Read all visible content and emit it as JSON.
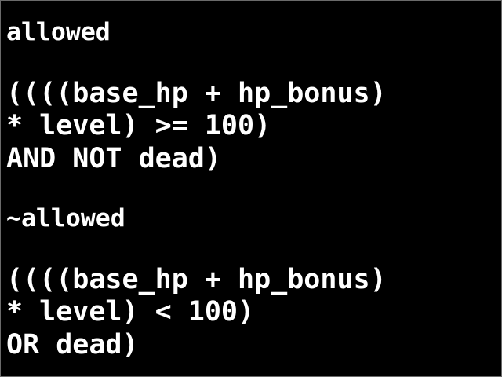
{
  "sections": [
    {
      "heading": "allowed",
      "lines": [
        "((((base_hp + hp_bonus)",
        "* level) >= 100)",
        "AND NOT dead)"
      ]
    },
    {
      "heading": "~allowed",
      "lines": [
        "((((base_hp + hp_bonus)",
        "* level) < 100)",
        "OR dead)"
      ]
    }
  ]
}
